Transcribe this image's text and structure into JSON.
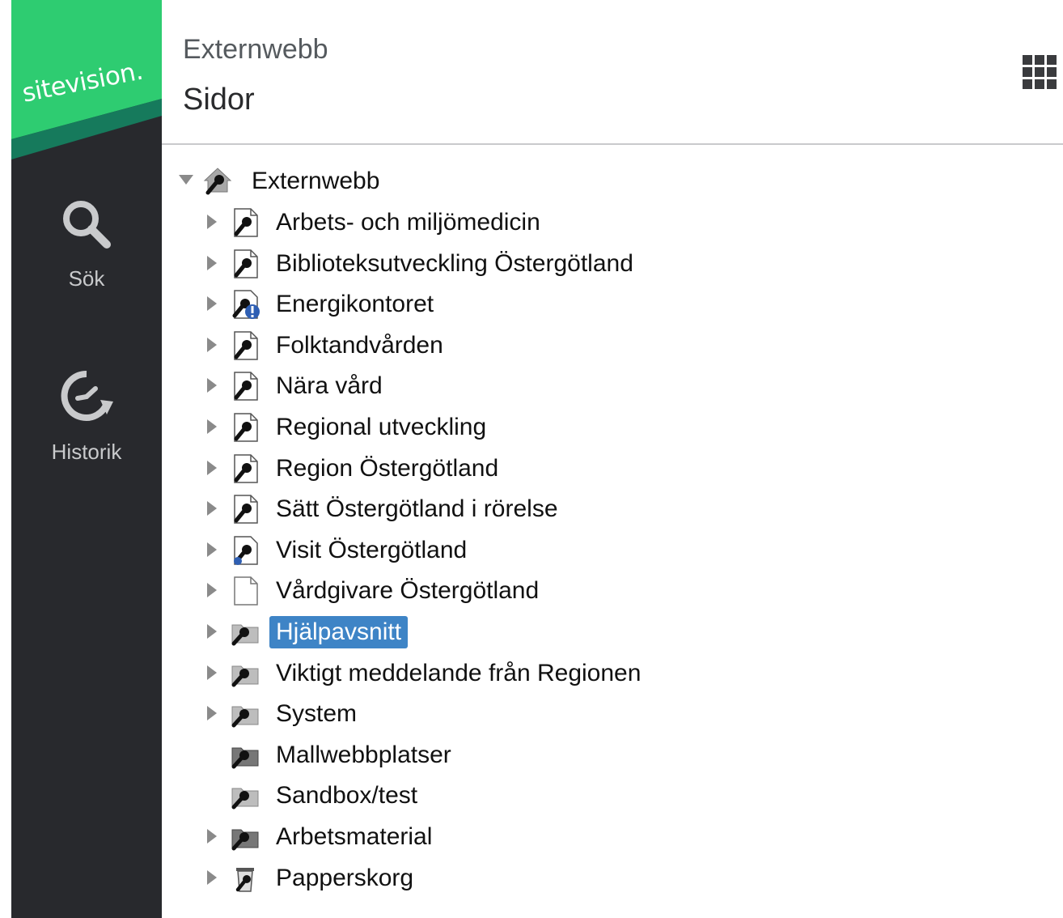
{
  "brand": {
    "logo_text": "sitevision.",
    "green": "#2ecc71",
    "dark_green": "#167a5c",
    "sidebar_bg": "#28292d"
  },
  "nav": {
    "search": {
      "label": "Sök",
      "icon": "search-icon"
    },
    "history": {
      "label": "Historik",
      "icon": "history-icon"
    }
  },
  "header": {
    "site_name": "Externwebb",
    "title": "Sidor",
    "apps_icon": "grid-icon"
  },
  "tree": {
    "root": {
      "label": "Externwebb",
      "expanded": true,
      "icon": "site-root-icon"
    },
    "children": [
      {
        "label": "Arbets- och miljömedicin",
        "icon": "page-key-icon",
        "has_children": true
      },
      {
        "label": "Biblioteksutveckling Östergötland",
        "icon": "page-key-icon",
        "has_children": true
      },
      {
        "label": "Energikontoret",
        "icon": "page-key-warning-icon",
        "has_children": true
      },
      {
        "label": "Folktandvården",
        "icon": "page-key-icon",
        "has_children": true
      },
      {
        "label": "Nära vård",
        "icon": "page-key-icon",
        "has_children": true
      },
      {
        "label": "Regional utveckling",
        "icon": "page-key-icon",
        "has_children": true
      },
      {
        "label": "Region Östergötland",
        "icon": "page-key-icon",
        "has_children": true
      },
      {
        "label": "Sätt Östergötland i rörelse",
        "icon": "page-key-icon",
        "has_children": true
      },
      {
        "label": "Visit Östergötland",
        "icon": "page-key-blue-icon",
        "has_children": true
      },
      {
        "label": "Vårdgivare Östergötland",
        "icon": "page-icon",
        "has_children": true
      },
      {
        "label": "Hjälpavsnitt",
        "icon": "folder-key-icon",
        "has_children": true,
        "selected": true
      },
      {
        "label": "Viktigt meddelande från Regionen",
        "icon": "folder-key-icon",
        "has_children": true
      },
      {
        "label": "System",
        "icon": "folder-key-icon",
        "has_children": true
      },
      {
        "label": "Mallwebbplatser",
        "icon": "folder-key-dark-icon",
        "has_children": false
      },
      {
        "label": "Sandbox/test",
        "icon": "folder-key-icon",
        "has_children": false
      },
      {
        "label": "Arbetsmaterial",
        "icon": "folder-key-dark-icon",
        "has_children": true
      },
      {
        "label": "Papperskorg",
        "icon": "trash-key-icon",
        "has_children": true
      }
    ]
  },
  "colors": {
    "selection": "#3e84c6",
    "divider": "#c9cacc",
    "twisty": "#8a8a8a"
  }
}
